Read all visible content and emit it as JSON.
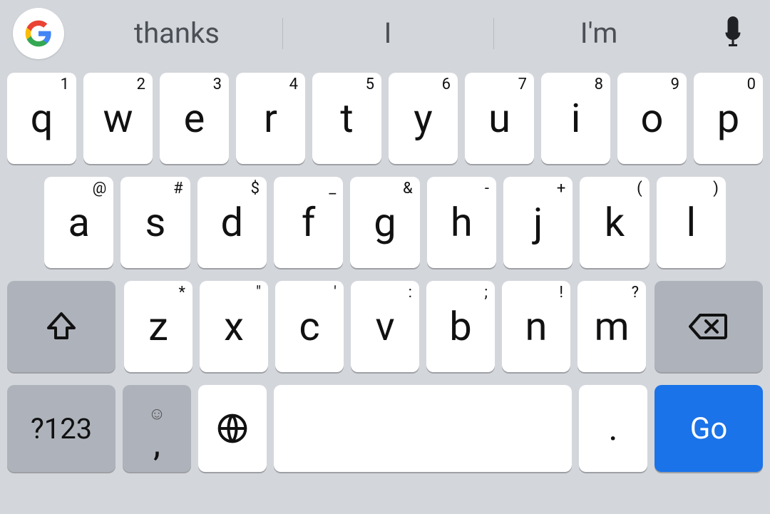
{
  "suggestions": [
    "thanks",
    "I",
    "I'm"
  ],
  "row1": [
    {
      "main": "q",
      "hint": "1"
    },
    {
      "main": "w",
      "hint": "2"
    },
    {
      "main": "e",
      "hint": "3"
    },
    {
      "main": "r",
      "hint": "4"
    },
    {
      "main": "t",
      "hint": "5"
    },
    {
      "main": "y",
      "hint": "6"
    },
    {
      "main": "u",
      "hint": "7"
    },
    {
      "main": "i",
      "hint": "8"
    },
    {
      "main": "o",
      "hint": "9"
    },
    {
      "main": "p",
      "hint": "0"
    }
  ],
  "row2": [
    {
      "main": "a",
      "hint": "@"
    },
    {
      "main": "s",
      "hint": "#"
    },
    {
      "main": "d",
      "hint": "$"
    },
    {
      "main": "f",
      "hint": "_"
    },
    {
      "main": "g",
      "hint": "&"
    },
    {
      "main": "h",
      "hint": "-"
    },
    {
      "main": "j",
      "hint": "+"
    },
    {
      "main": "k",
      "hint": "("
    },
    {
      "main": "l",
      "hint": ")"
    }
  ],
  "row3": [
    {
      "main": "z",
      "hint": "*"
    },
    {
      "main": "x",
      "hint": "\""
    },
    {
      "main": "c",
      "hint": "'"
    },
    {
      "main": "v",
      "hint": ":"
    },
    {
      "main": "b",
      "hint": ";"
    },
    {
      "main": "n",
      "hint": "!"
    },
    {
      "main": "m",
      "hint": "?"
    }
  ],
  "symbols_label": "?123",
  "comma_label": ",",
  "period_label": ".",
  "go_label": "Go"
}
